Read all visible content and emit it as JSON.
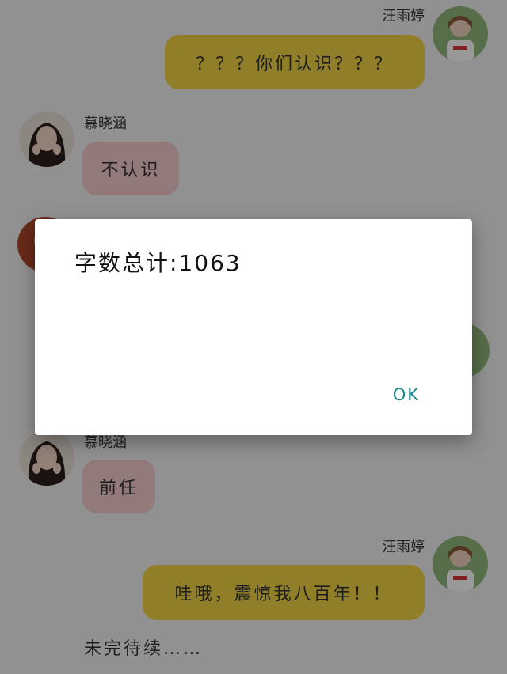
{
  "messages": [
    {
      "sender": "汪雨婷",
      "side": "right",
      "text": "？？？你们认识？？？",
      "color": "yellow"
    },
    {
      "sender": "慕晓涵",
      "side": "left",
      "text": "不认识",
      "color": "pink"
    },
    {
      "sender": "慕晓涵",
      "side": "left",
      "text": "前任",
      "color": "pink"
    },
    {
      "sender": "汪雨婷",
      "side": "right",
      "text": "哇哦，震惊我八百年！！",
      "color": "yellow"
    }
  ],
  "narration": "未完待续……",
  "dialog": {
    "message": "字数总计:1063",
    "ok_label": "OK"
  },
  "colors": {
    "yellow_bubble": "#f0d443",
    "pink_bubble": "#f6cccc",
    "ok_accent": "#148a8c",
    "scrim": "rgba(0,0,0,0.40)"
  },
  "icons": {
    "avatar_right": "avatar-girl-white-shirt",
    "avatar_left": "avatar-girl-dark-hair",
    "avatar_partial": "avatar-partial"
  }
}
